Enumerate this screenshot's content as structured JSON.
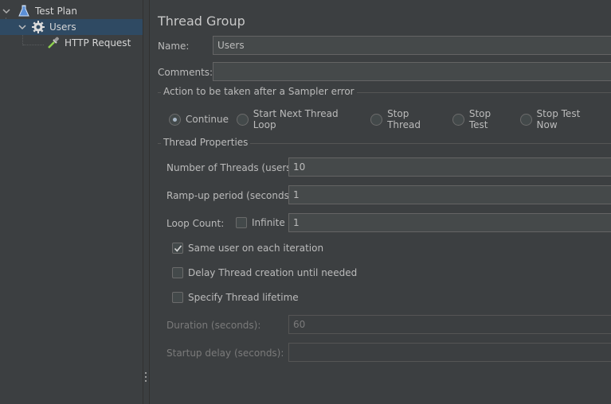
{
  "tree": {
    "items": [
      {
        "label": "Test Plan",
        "icon": "test-plan-icon"
      },
      {
        "label": "Users",
        "icon": "gear-icon"
      },
      {
        "label": "HTTP Request",
        "icon": "pipette-icon"
      }
    ]
  },
  "panel": {
    "title": "Thread Group",
    "name_label": "Name:",
    "name_value": "Users",
    "comments_label": "Comments:",
    "comments_value": "",
    "sampler_error": {
      "title": "Action to be taken after a Sampler error",
      "options": [
        "Continue",
        "Start Next Thread Loop",
        "Stop Thread",
        "Stop Test",
        "Stop Test Now"
      ],
      "selected": "Continue"
    },
    "thread_props": {
      "title": "Thread Properties",
      "threads_label": "Number of Threads (users):",
      "threads_value": "10",
      "rampup_label": "Ramp-up period (seconds):",
      "rampup_value": "1",
      "loop_label": "Loop Count:",
      "infinite_label": "Infinite",
      "infinite_checked": false,
      "loop_value": "1",
      "same_user_label": "Same user on each iteration",
      "same_user_checked": true,
      "delay_label": "Delay Thread creation until needed",
      "delay_checked": false,
      "lifetime_label": "Specify Thread lifetime",
      "lifetime_checked": false,
      "duration_label": "Duration (seconds):",
      "duration_value": "60",
      "startup_label": "Startup delay (seconds):",
      "startup_value": ""
    }
  },
  "colors": {
    "background": "#3c3f41",
    "selection": "#2f4a63",
    "field": "#45494a",
    "text": "#bbbbbb"
  }
}
